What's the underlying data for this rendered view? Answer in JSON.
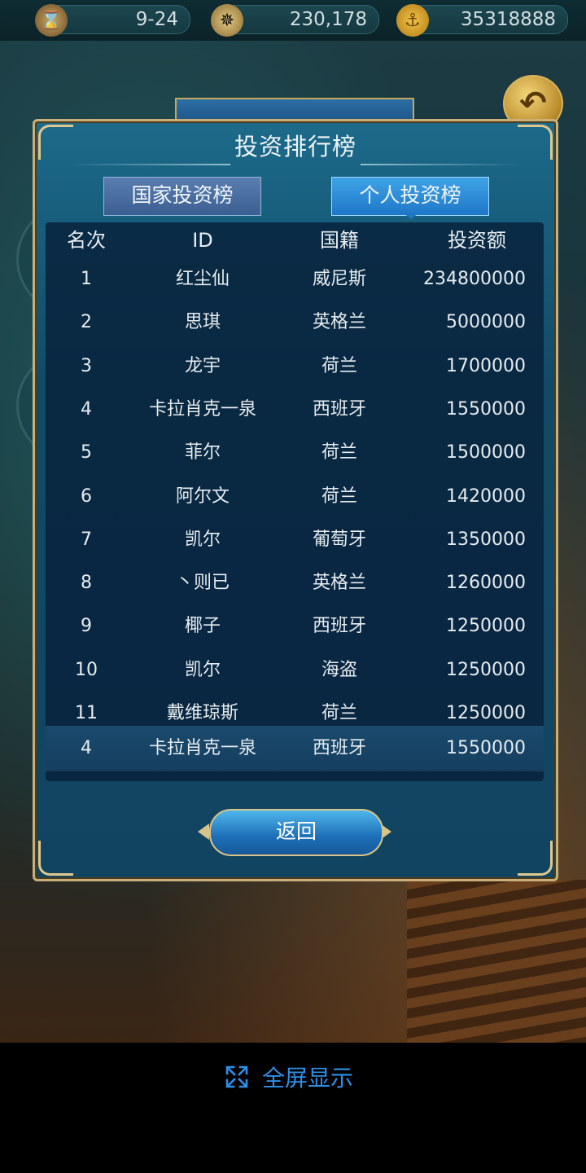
{
  "top_bar": {
    "date": "9-24",
    "date_icon": "hourglass-icon",
    "compass_value": "230,178",
    "compass_icon": "compass-icon",
    "gold_value": "35318888",
    "gold_icon": "anchor-coin-icon"
  },
  "dialog": {
    "title": "投资排行榜",
    "tabs": [
      {
        "label": "国家投资榜",
        "active": false
      },
      {
        "label": "个人投资榜",
        "active": true
      }
    ],
    "columns": [
      "名次",
      "ID",
      "国籍",
      "投资额"
    ],
    "rows": [
      {
        "rank": "1",
        "id": "红尘仙",
        "nationality": "威尼斯",
        "amount": "234800000"
      },
      {
        "rank": "2",
        "id": "思琪",
        "nationality": "英格兰",
        "amount": "5000000"
      },
      {
        "rank": "3",
        "id": "龙宇",
        "nationality": "荷兰",
        "amount": "1700000"
      },
      {
        "rank": "4",
        "id": "卡拉肖克一泉",
        "nationality": "西班牙",
        "amount": "1550000"
      },
      {
        "rank": "5",
        "id": "菲尔",
        "nationality": "荷兰",
        "amount": "1500000"
      },
      {
        "rank": "6",
        "id": "阿尔文",
        "nationality": "荷兰",
        "amount": "1420000"
      },
      {
        "rank": "7",
        "id": "凯尔",
        "nationality": "葡萄牙",
        "amount": "1350000"
      },
      {
        "rank": "8",
        "id": "丶则已",
        "nationality": "英格兰",
        "amount": "1260000"
      },
      {
        "rank": "9",
        "id": "椰子",
        "nationality": "西班牙",
        "amount": "1250000"
      },
      {
        "rank": "10",
        "id": "凯尔",
        "nationality": "海盗",
        "amount": "1250000"
      },
      {
        "rank": "11",
        "id": "戴维琼斯",
        "nationality": "荷兰",
        "amount": "1250000"
      }
    ],
    "my_rank": {
      "rank": "4",
      "id": "卡拉肖克一泉",
      "nationality": "西班牙",
      "amount": "1550000"
    },
    "back_label": "返回"
  },
  "fullscreen": {
    "label": "全屏显示",
    "icon": "expand-icon",
    "color": "#2e8fe8"
  },
  "colors": {
    "dialog_border": "#c9b07a",
    "active_tab": "#1f77c8",
    "inactive_tab": "#3c5f92"
  }
}
